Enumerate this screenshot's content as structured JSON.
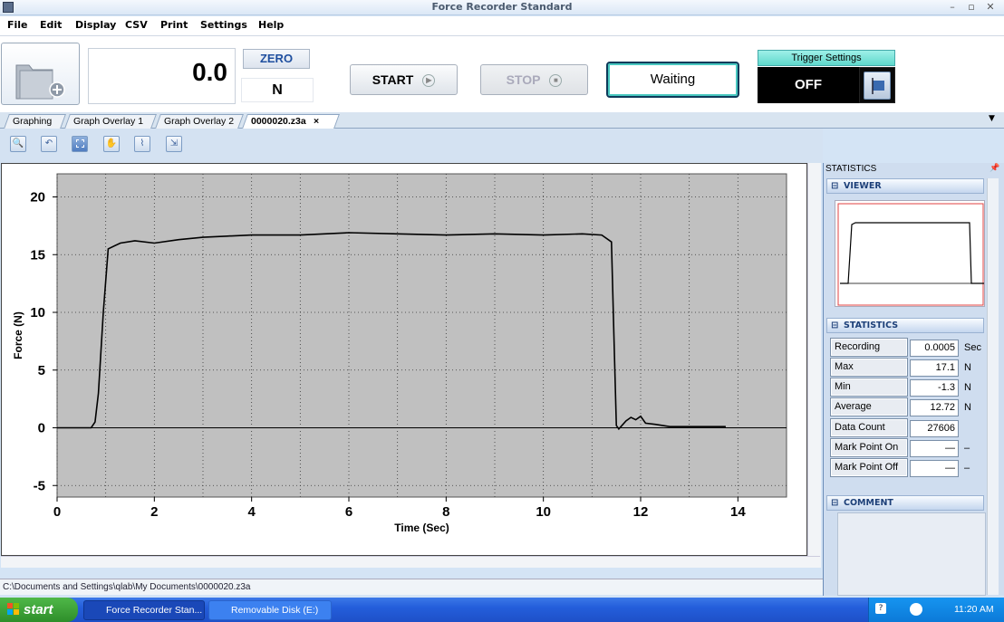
{
  "window": {
    "title": "Force Recorder Standard"
  },
  "menu": [
    "File",
    "Edit",
    "Display",
    "CSV",
    "Print",
    "Settings",
    "Help"
  ],
  "toolbar": {
    "readout_value": "0.0",
    "zero_label": "ZERO",
    "unit": "N",
    "start_label": "START",
    "stop_label": "STOP",
    "status": "Waiting",
    "trigger_label": "Trigger Settings",
    "trigger_state": "OFF"
  },
  "tabs": [
    {
      "label": "Graphing"
    },
    {
      "label": "Graph Overlay 1"
    },
    {
      "label": "Graph Overlay 2"
    },
    {
      "label": "0000020.z3a",
      "close": "×",
      "active": true
    }
  ],
  "chart_data": {
    "type": "line",
    "xlabel": "Time (Sec)",
    "ylabel": "Force (N)",
    "xlim": [
      0,
      15
    ],
    "ylim": [
      -6,
      22
    ],
    "xticks": [
      0,
      2,
      4,
      6,
      8,
      10,
      12,
      14
    ],
    "yticks": [
      -5,
      0,
      5,
      10,
      15,
      20
    ],
    "grid": true,
    "series": [
      {
        "x": [
          0,
          0.7,
          0.78,
          0.85,
          0.95,
          1.05,
          1.3,
          1.6,
          2.0,
          2.5,
          3.0,
          3.5,
          4.0,
          5.0,
          6.0,
          7.0,
          8.0,
          9.0,
          10.0,
          10.8,
          11.2,
          11.4,
          11.45,
          11.5,
          11.55,
          11.7,
          11.8,
          11.9,
          12.0,
          12.1,
          12.3,
          12.6,
          13.0,
          13.75
        ],
        "y": [
          0,
          0,
          0.5,
          3,
          10,
          15.5,
          16.0,
          16.2,
          16.0,
          16.3,
          16.5,
          16.6,
          16.7,
          16.7,
          16.9,
          16.8,
          16.7,
          16.8,
          16.7,
          16.8,
          16.7,
          16.1,
          8,
          0.2,
          -0.1,
          0.6,
          0.9,
          0.7,
          1.0,
          0.4,
          0.3,
          0.1,
          0.1,
          0.1
        ]
      }
    ]
  },
  "file_path": "C:\\Documents and Settings\\qlab\\My Documents\\0000020.z3a",
  "panel": {
    "title": "STATISTICS",
    "viewer_header": "VIEWER",
    "stats_header": "STATISTICS",
    "comment_header": "COMMENT",
    "stats": [
      {
        "label": "Recording",
        "value": "0.0005",
        "unit": "Sec"
      },
      {
        "label": "Max",
        "value": "17.1",
        "unit": "N"
      },
      {
        "label": "Min",
        "value": "-1.3",
        "unit": "N"
      },
      {
        "label": "Average",
        "value": "12.72",
        "unit": "N"
      },
      {
        "label": "Data Count",
        "value": "27606",
        "unit": ""
      },
      {
        "label": "Mark Point On",
        "value": "—",
        "unit": "–"
      },
      {
        "label": "Mark Point Off",
        "value": "—",
        "unit": "–"
      }
    ]
  },
  "taskbar": {
    "start": "start",
    "task1": "Force Recorder Stan...",
    "task2": "Removable Disk (E:)",
    "clock": "11:20 AM"
  }
}
